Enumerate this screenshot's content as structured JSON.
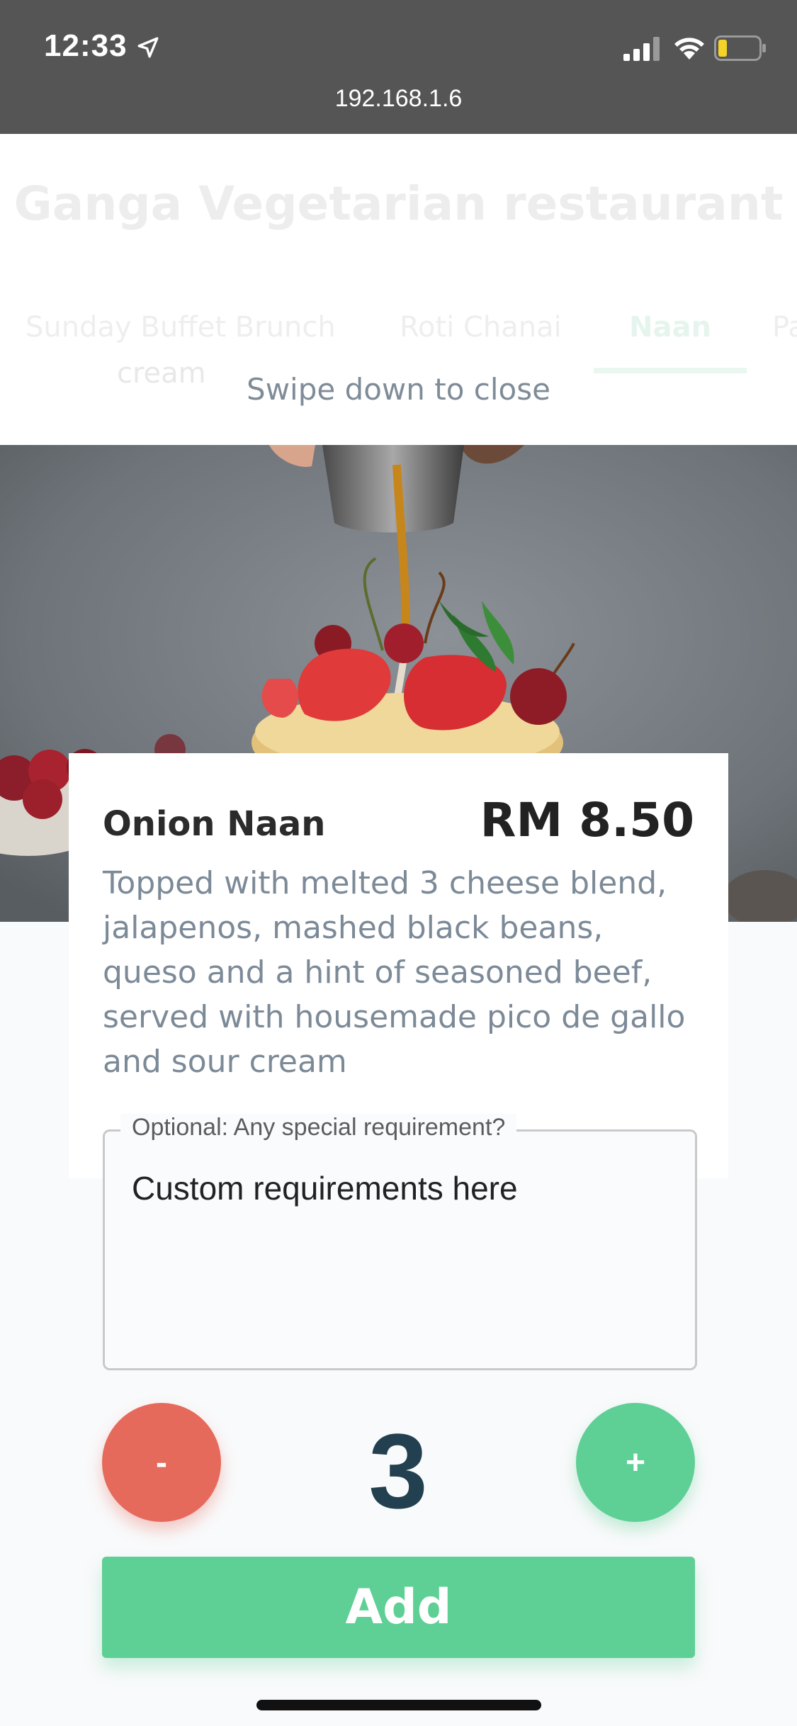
{
  "status_bar": {
    "time": "12:33",
    "url": "192.168.1.6",
    "icons": [
      "location-arrow-icon",
      "signal-icon",
      "wifi-icon",
      "battery-icon"
    ]
  },
  "background_page": {
    "title": "Ganga Vegetarian restaurant",
    "tabs": [
      {
        "label": "Sunday Buffet Brunch"
      },
      {
        "label": "Roti Chanai"
      },
      {
        "label": "Naan",
        "active": true
      },
      {
        "label": "Pa"
      }
    ],
    "partial_text": "cream"
  },
  "modal": {
    "swipe_hint": "Swipe down to close",
    "item": {
      "name": "Onion Naan",
      "price": "RM 8.50",
      "description": "Topped with melted 3 cheese blend, jalapenos, mashed black beans, queso and a hint of seasoned beef, served with housemade pico de gallo and sour cream"
    },
    "requirements": {
      "legend": "Optional: Any special requirement?",
      "value": "Custom requirements here"
    },
    "quantity": {
      "minus_label": "-",
      "value": "3",
      "plus_label": "+"
    },
    "add_label": "Add"
  },
  "colors": {
    "accent_green": "#5ecf95",
    "minus_red": "#e66a5c",
    "quantity_text": "#22404f",
    "status_bar": "#555555"
  }
}
